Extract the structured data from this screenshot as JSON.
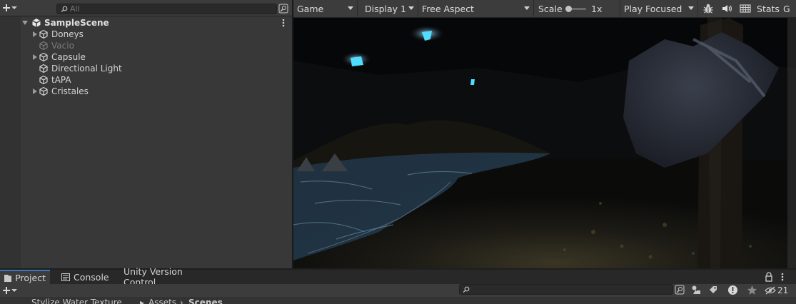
{
  "hierarchy": {
    "search_placeholder": "All",
    "scene_name": "SampleScene",
    "items": [
      {
        "label": "Doneys",
        "has_children": true,
        "dimmed": false
      },
      {
        "label": "Vacio",
        "has_children": false,
        "dimmed": true
      },
      {
        "label": "Capsule",
        "has_children": true,
        "dimmed": false
      },
      {
        "label": "Directional Light",
        "has_children": false,
        "dimmed": false
      },
      {
        "label": "tAPA",
        "has_children": false,
        "dimmed": false
      },
      {
        "label": "Cristales",
        "has_children": true,
        "dimmed": false
      }
    ]
  },
  "game_toolbar": {
    "view_label": "Game",
    "display_label": "Display 1",
    "aspect_label": "Free Aspect",
    "scale_label": "Scale",
    "scale_value": "1x",
    "play_mode_label": "Play Focused",
    "stats_label": "Stats",
    "gizmos_label_partial": "G"
  },
  "bottom_panel": {
    "tabs": [
      {
        "label": "Project",
        "active": true,
        "icon": "folder-icon"
      },
      {
        "label": "Console",
        "active": false,
        "icon": "console-icon"
      },
      {
        "label": "Unity Version Control",
        "active": false,
        "icon": ""
      }
    ],
    "hidden_packages_count": "21",
    "breadcrumbs": [
      "Stylize Water Texture",
      "Assets",
      "Scenes"
    ]
  },
  "colors": {
    "panel_bg": "#383838",
    "toolbar_bg": "#3c3c3c",
    "active_tab_accent": "#3a79bb",
    "crystal_glow": "#4fdcff"
  }
}
